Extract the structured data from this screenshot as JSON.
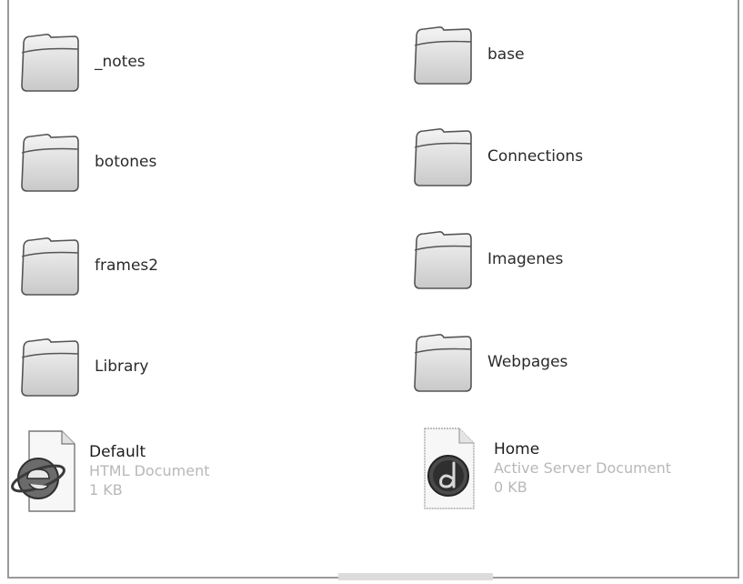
{
  "folders": [
    {
      "label": "_notes"
    },
    {
      "label": "base"
    },
    {
      "label": "botones"
    },
    {
      "label": "Connections"
    },
    {
      "label": "frames2"
    },
    {
      "label": "Imagenes"
    },
    {
      "label": "Library"
    },
    {
      "label": "Webpages"
    }
  ],
  "files": [
    {
      "name": "Default",
      "type": "HTML Document",
      "size": "1 KB",
      "icon": "ie-html-icon"
    },
    {
      "name": "Home",
      "type": "Active Server Document",
      "size": "0 KB",
      "icon": "dreamweaver-asp-icon"
    }
  ],
  "colors": {
    "folder_fill": "#e6e6e6",
    "folder_stroke": "#5a5a5a",
    "subtext": "#b8b8b8"
  }
}
